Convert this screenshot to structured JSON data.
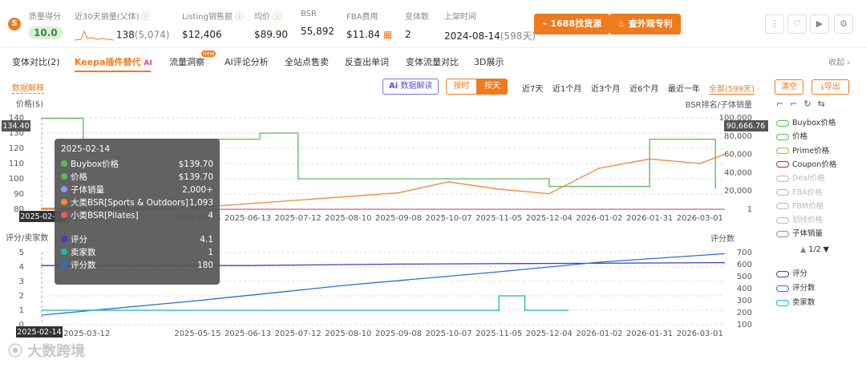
{
  "stats": {
    "quality": {
      "label": "质量得分",
      "value": "10.0"
    },
    "sales": {
      "label": "近30天销量(父体)",
      "value": "138",
      "sub": "(5,074)"
    },
    "listing_sales": {
      "label": "Listing销售额",
      "value": "$12,406"
    },
    "avg_price": {
      "label": "均价",
      "value": "$89.90"
    },
    "bsr": {
      "label": "BSR",
      "value": "55,892"
    },
    "fba": {
      "label": "FBA费用",
      "value": "$11.84"
    },
    "variants": {
      "label": "变体数",
      "value": "2"
    },
    "listed": {
      "label": "上架时间",
      "value": "2024-08-14",
      "sub": "(598天)"
    }
  },
  "buttons": {
    "source": "1688找货源",
    "patent": "查外观专利"
  },
  "tabs": [
    "变体对比(2)",
    "Keepa插件替代",
    "流量洞察",
    "AI评论分析",
    "全站点售卖",
    "反查出单词",
    "变体流量对比",
    "3D展示"
  ],
  "tab_badge_new": "new",
  "tab_ai": "AI",
  "collapse": "收起",
  "data_explain": "数据解释",
  "ai_read": "数据解读",
  "granularity": {
    "hour": "按时",
    "day": "按天"
  },
  "ranges": [
    "近7天",
    "近1个月",
    "近3个月",
    "近6个月",
    "最近一年",
    "全部(599天)"
  ],
  "clear": "清空",
  "export": "导出",
  "top_chart": {
    "ylabel_left": "价格($)",
    "ylabel_right": "BSR排名/子体销量",
    "left_value": "134.40",
    "right_value": "90,666.76"
  },
  "bottom_chart": {
    "ylabel_left": "评分/卖家数",
    "ylabel_right": "评分数",
    "date_marker": "2025-02-14"
  },
  "legend_top": [
    {
      "label": "Buybox价格",
      "color": "#5cb85c",
      "active": true
    },
    {
      "label": "价格",
      "color": "#5cb85c",
      "active": true
    },
    {
      "label": "Prime价格",
      "color": "#8bc34a",
      "active": true
    },
    {
      "label": "Coupon价格",
      "color": "#c2185b",
      "active": true
    },
    {
      "label": "Deal价格",
      "color": "#bbbbbb",
      "active": false
    },
    {
      "label": "FBA价格",
      "color": "#bbbbbb",
      "active": false
    },
    {
      "label": "FBM价格",
      "color": "#bbbbbb",
      "active": false
    },
    {
      "label": "划线价格",
      "color": "#bbbbbb",
      "active": false
    },
    {
      "label": "子体销量",
      "color": "#7b8fd9",
      "active": true
    }
  ],
  "pager": "1/2",
  "legend_bottom": [
    {
      "label": "评分",
      "color": "#3f3fbf"
    },
    {
      "label": "评分数",
      "color": "#2a6fd6"
    },
    {
      "label": "卖家数",
      "color": "#1bb5b5"
    }
  ],
  "tooltip": {
    "date": "2025-02-14",
    "rows": [
      {
        "label": "Buybox价格",
        "value": "$139.70",
        "color": "#5cb85c"
      },
      {
        "label": "价格",
        "value": "$139.70",
        "color": "#5cb85c"
      },
      {
        "label": "子体销量",
        "value": "2,000+",
        "color": "#8a9cf5"
      },
      {
        "label": "大类BSR[Sports & Outdoors]",
        "value": "1,093",
        "color": "#f0883a"
      },
      {
        "label": "小类BSR[Pilates]",
        "value": "4",
        "color": "#e85c5c"
      }
    ],
    "rows2": [
      {
        "label": "评分",
        "value": "4.1",
        "color": "#3f3fbf"
      },
      {
        "label": "卖家数",
        "value": "1",
        "color": "#1bb5b5"
      },
      {
        "label": "评分数",
        "value": "180",
        "color": "#2a6fd6"
      }
    ]
  },
  "watermark": "大数跨境",
  "chart_data": [
    {
      "type": "line",
      "title": "",
      "ylabel": "价格($)",
      "ylabel_right": "BSR排名/子体销量",
      "x_ticks": [
        "2025-03-12",
        "2025-05-15",
        "2025-06-13",
        "2025-07-12",
        "2025-08-10",
        "2025-09-08",
        "2025-10-07",
        "2025-11-05",
        "2025-12-04",
        "2026-01-02",
        "2026-01-31",
        "2026-03-01"
      ],
      "ylim": [
        80,
        140
      ],
      "yticks_left": [
        80,
        90,
        100,
        110,
        120,
        130,
        140
      ],
      "yticks_right": [
        "1",
        "20,000",
        "40,000",
        "60,000",
        "80,000",
        "100,000"
      ],
      "series": [
        {
          "name": "价格",
          "axis": "left",
          "color": "#5cb85c",
          "points": [
            [
              "2025-02-14",
              139.7
            ],
            [
              "2025-03-10",
              126
            ],
            [
              "2025-04-15",
              126
            ],
            [
              "2025-05-20",
              126
            ],
            [
              "2025-06-20",
              130
            ],
            [
              "2025-07-12",
              100
            ],
            [
              "2025-10-07",
              100
            ],
            [
              "2025-12-04",
              95
            ],
            [
              "2026-01-02",
              95
            ],
            [
              "2026-01-31",
              126
            ],
            [
              "2026-03-01",
              126
            ],
            [
              "2026-03-10",
              94
            ]
          ]
        },
        {
          "name": "大类BSR[Sports & Outdoors]",
          "axis": "right",
          "color": "#f0883a",
          "points": [
            [
              "2025-02-14",
              1093
            ],
            [
              "2025-05-15",
              2000
            ],
            [
              "2025-07-12",
              10000
            ],
            [
              "2025-08-10",
              14000
            ],
            [
              "2025-09-08",
              18000
            ],
            [
              "2025-10-07",
              30000
            ],
            [
              "2025-11-05",
              22000
            ],
            [
              "2025-12-04",
              17000
            ],
            [
              "2026-01-02",
              45000
            ],
            [
              "2026-01-31",
              55000
            ],
            [
              "2026-03-01",
              50000
            ],
            [
              "2026-03-15",
              60000
            ]
          ]
        },
        {
          "name": "小类BSR[Pilates]",
          "axis": "right",
          "color": "#e85c5c",
          "points": [
            [
              "2025-02-14",
              4
            ],
            [
              "2026-03-15",
              4
            ]
          ]
        }
      ]
    },
    {
      "type": "line",
      "title": "",
      "ylabel": "评分/卖家数",
      "ylabel_right": "评分数",
      "x_ticks": [
        "2025-03-12",
        "2025-05-15",
        "2025-06-13",
        "2025-07-12",
        "2025-08-10",
        "2025-09-08",
        "2025-10-07",
        "2025-11-05",
        "2025-12-04",
        "2026-01-02",
        "2026-01-31",
        "2026-03-01"
      ],
      "ylim": [
        0,
        5
      ],
      "yticks_left": [
        0,
        1,
        2,
        3,
        4,
        5
      ],
      "yticks_right": [
        100,
        200,
        300,
        400,
        500,
        600,
        700
      ],
      "series": [
        {
          "name": "评分",
          "axis": "left",
          "color": "#3f3fbf",
          "points": [
            [
              "2025-02-14",
              4.1
            ],
            [
              "2025-06-13",
              4.1
            ],
            [
              "2025-09-08",
              4.2
            ],
            [
              "2026-03-15",
              4.3
            ]
          ]
        },
        {
          "name": "评分数",
          "axis": "right",
          "color": "#2a6fd6",
          "points": [
            [
              "2025-02-14",
              180
            ],
            [
              "2025-05-15",
              300
            ],
            [
              "2025-08-10",
              430
            ],
            [
              "2025-11-05",
              540
            ],
            [
              "2026-01-02",
              620
            ],
            [
              "2026-03-15",
              690
            ]
          ]
        },
        {
          "name": "卖家数",
          "axis": "left",
          "color": "#1bb5b5",
          "points": [
            [
              "2025-02-14",
              1
            ],
            [
              "2025-11-05",
              1
            ],
            [
              "2025-11-05",
              2
            ],
            [
              "2025-11-20",
              2
            ],
            [
              "2025-11-20",
              1
            ],
            [
              "2025-12-15",
              1
            ]
          ]
        }
      ]
    }
  ]
}
